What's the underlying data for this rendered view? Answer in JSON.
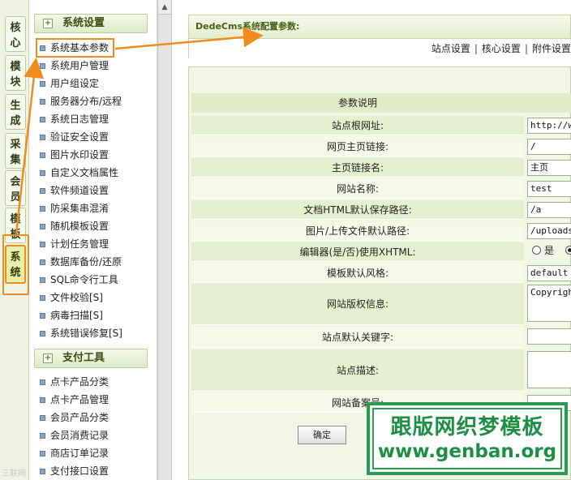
{
  "vertical_tabs": [
    "核心",
    "模块",
    "生成",
    "采集",
    "会员",
    "模板",
    "系统"
  ],
  "active_tab": "系统",
  "menu": {
    "system_section": "系统设置",
    "system_items": [
      "系统基本参数",
      "系统用户管理",
      "用户组设定",
      "服务器分布/远程",
      "系统日志管理",
      "验证安全设置",
      "图片水印设置",
      "自定义文档属性",
      "软件频道设置",
      "防采集串混淆",
      "随机模板设置",
      "计划任务管理",
      "数据库备份/还原",
      "SQL命令行工具",
      "文件校验[S]",
      "病毒扫描[S]",
      "系统错误修复[S]"
    ],
    "pay_section": "支付工具",
    "pay_items": [
      "点卡产品分类",
      "点卡产品管理",
      "会员产品分类",
      "会员消费记录",
      "商店订单记录",
      "支付接口设置"
    ]
  },
  "main": {
    "title": "DedeCms系统配置参数:",
    "subnav": [
      "站点设置",
      "核心设置",
      "附件设置"
    ],
    "col_header": "参数说明",
    "fields": [
      {
        "label": "站点根网址:",
        "value": "http://w"
      },
      {
        "label": "网页主页链接:",
        "value": "/"
      },
      {
        "label": "主页链接名:",
        "value": "主页"
      },
      {
        "label": "网站名称:",
        "value": "test"
      },
      {
        "label": "文档HTML默认保存路径:",
        "value": "/a"
      },
      {
        "label": "图片/上传文件默认路径:",
        "value": "/uploads"
      },
      {
        "label": "编辑器(是/否)使用XHTML:",
        "value": ""
      },
      {
        "label": "模板默认风格:",
        "value": "default"
      },
      {
        "label": "网站版权信息:",
        "value": "Copyright"
      },
      {
        "label": "站点默认关键字:",
        "value": ""
      },
      {
        "label": "站点描述:",
        "value": ""
      },
      {
        "label": "网站备案号:",
        "value": ""
      }
    ],
    "radio_yes": "是",
    "confirm_button": "确定"
  },
  "watermark": {
    "line1": "跟版网织梦模板",
    "line2": "www.genban.org"
  },
  "corner_mark": "三联网",
  "colors": {
    "highlight": "#f08c1c",
    "panel": "#f1f6e6",
    "watermark": "#1d8f43"
  }
}
